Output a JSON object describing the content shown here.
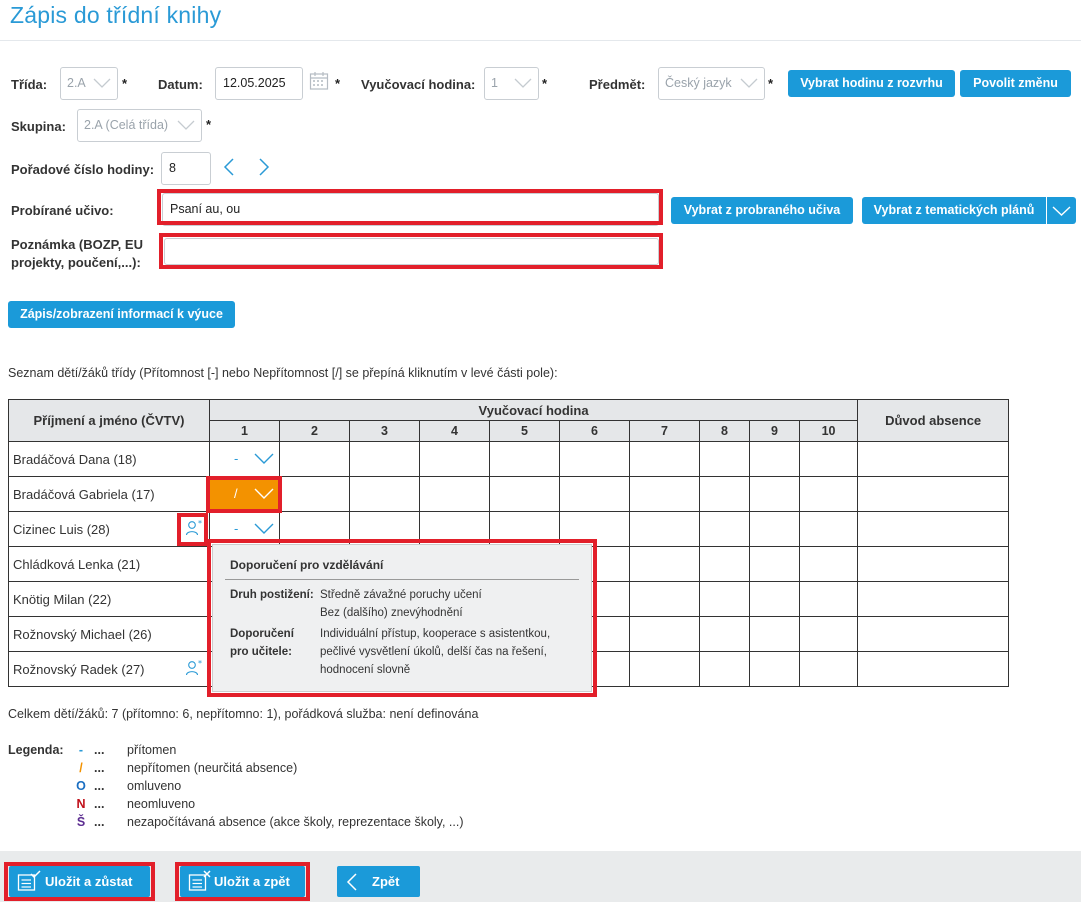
{
  "header": {
    "title": "Zápis do třídní knihy"
  },
  "form": {
    "class_label": "Třída:",
    "class_value": "2.A",
    "date_label": "Datum:",
    "date_value": "12.05.2025",
    "lesson_label": "Vyučovací hodina:",
    "lesson_value": "1",
    "subject_label": "Předmět:",
    "subject_value": "Český jazyk",
    "required_mark": "*",
    "group_label": "Skupina:",
    "group_value": "2.A (Celá třída)",
    "order_label": "Pořadové číslo hodiny:",
    "order_value": "8",
    "topic_label": "Probírané učivo:",
    "topic_value": "Psaní au, ou",
    "note_label_line1": "Poznámka (BOZP, EU",
    "note_label_line2": "projekty, poučení,...):",
    "note_value": ""
  },
  "buttons": {
    "pick_from_schedule": "Vybrat hodinu z rozvrhu",
    "allow_change": "Povolit změnu",
    "pick_from_topics": "Vybrat z probraného učiva",
    "pick_from_plans": "Vybrat z tematických plánů",
    "lesson_info": "Zápis/zobrazení informací k výuce"
  },
  "attendance": {
    "caption": "Seznam dětí/žáků třídy (Přítomnost [-] nebo Nepřítomnost [/] se přepíná kliknutím v levé části pole):",
    "col_name": "Příjmení a jméno (ČVTV)",
    "col_lessons": "Vyučovací hodina",
    "col_reason": "Důvod absence",
    "lesson_numbers": [
      "1",
      "2",
      "3",
      "4",
      "5",
      "6",
      "7",
      "8",
      "9",
      "10"
    ],
    "students": [
      {
        "name": "Bradáčová Dana (18)",
        "mark": "-",
        "absent": false,
        "support": false
      },
      {
        "name": "Bradáčová Gabriela (17)",
        "mark": "/",
        "absent": true,
        "support": false
      },
      {
        "name": "Cizinec Luis (28)",
        "mark": "-",
        "absent": false,
        "support": true
      },
      {
        "name": "Chládková Lenka (21)",
        "mark": "",
        "absent": false,
        "support": false
      },
      {
        "name": "Knötig Milan (22)",
        "mark": "",
        "absent": false,
        "support": false
      },
      {
        "name": "Rožnovský Michael (26)",
        "mark": "",
        "absent": false,
        "support": false
      },
      {
        "name": "Rožnovský Radek (27)",
        "mark": "",
        "absent": false,
        "support": true
      }
    ]
  },
  "tooltip": {
    "title": "Doporučení pro vzdělávání",
    "disability_label": "Druh postižení:",
    "disability_line1": "Středně závažné poruchy učení",
    "disability_line2": "Bez (dalšího) znevýhodnění",
    "recommend_label_line1": "Doporučení",
    "recommend_label_line2": "pro učitele:",
    "recommend_line1": "Individuální přístup, kooperace s asistentkou,",
    "recommend_line2": "pečlivé vysvětlení úkolů, delší čas na řešení,",
    "recommend_line3": "hodnocení slovně"
  },
  "summary": "Celkem dětí/žáků: 7 (přítomno: 6, nepřítomno: 1), pořádková služba: není definována",
  "legend": {
    "title": "Legenda:",
    "dots": "...",
    "items": [
      {
        "symbol": "-",
        "color": "#2a9ad6",
        "text": "přítomen"
      },
      {
        "symbol": "/",
        "color": "#f39200",
        "text": "nepřítomen (neurčitá absence)"
      },
      {
        "symbol": "O",
        "color": "#1b6fc2",
        "text": "omluveno"
      },
      {
        "symbol": "N",
        "color": "#c0101a",
        "text": "neomluveno"
      },
      {
        "symbol": "Š",
        "color": "#5c2d91",
        "text": "nezapočítávaná absence (akce školy, reprezentace školy, ...)"
      }
    ]
  },
  "footer": {
    "save_stay": "Uložit a zůstat",
    "save_back": "Uložit a zpět",
    "back": "Zpět"
  },
  "colors": {
    "accent": "#1b9ad9",
    "highlight": "#e21f2a",
    "absent": "#f39200"
  }
}
